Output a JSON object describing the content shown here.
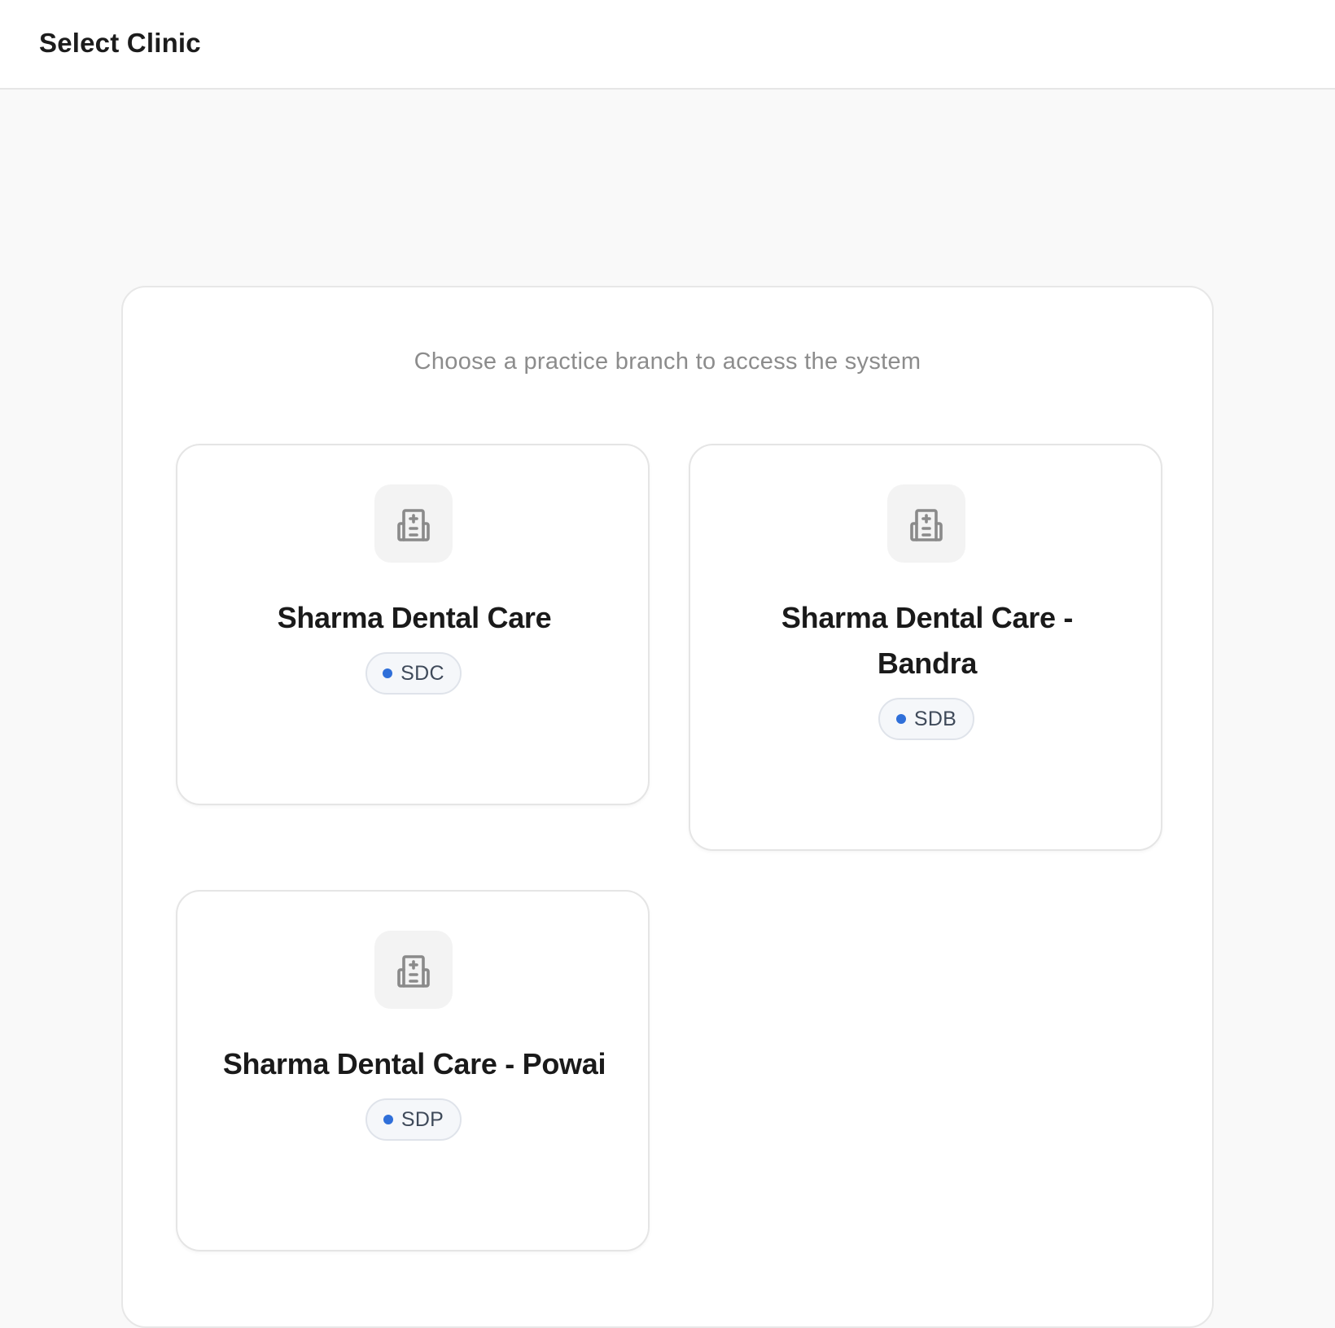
{
  "header": {
    "title": "Select Clinic"
  },
  "main": {
    "subtitle": "Choose a practice branch to access the system",
    "clinics": [
      {
        "name": "Sharma Dental Care",
        "code": "SDC",
        "icon": "hospital-building-icon"
      },
      {
        "name": "Sharma Dental Care - Bandra",
        "code": "SDB",
        "icon": "hospital-building-icon"
      },
      {
        "name": "Sharma Dental Care - Powai",
        "code": "SDP",
        "icon": "hospital-building-icon"
      }
    ]
  },
  "colors": {
    "accent": "#2f6fd9",
    "icon_gray": "#8a8a8a",
    "background": "#f9f9f9"
  }
}
